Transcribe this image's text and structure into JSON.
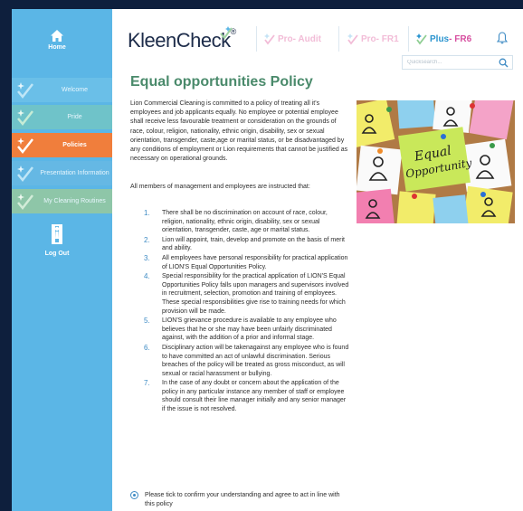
{
  "sidebar": {
    "home_label": "Home",
    "items": [
      {
        "label": "Welcome"
      },
      {
        "label": "Pride"
      },
      {
        "label": "Policies"
      },
      {
        "label": "Presentation Information"
      },
      {
        "label": "My Cleaning Routines"
      }
    ],
    "logout_label": "Log Out"
  },
  "header": {
    "logo_text": "KleenCheck",
    "logo_mark": "®",
    "tabs": [
      {
        "prefix": "Pro",
        "suffix": " - Audit"
      },
      {
        "prefix": "Pro",
        "suffix": " - FR1"
      },
      {
        "prefix": "Plus",
        "suffix": " - FR6"
      }
    ],
    "search_placeholder": "Quicksearch..."
  },
  "main": {
    "title": "Equal opportunities Policy",
    "intro": "Lion Commercial Cleaning is committed to a policy of treating all it's employees and job applicants equally. No employee or potential employee shall receive less favourable treatment or consideration on the grounds of race, colour, religion, nationality, ethnic origin, disability, sex or sexual orientation, transgender, caste,age or marital status, or be disadvantaged by any conditions of employment or Lion requirements that cannot be justified as necessary on operational grounds.",
    "members_intro": "All members of management and employees are instructed that:",
    "points": [
      {
        "num": "1.",
        "text": "There shall be no discrimination on account of race, colour, religion, nationality, ethnic origin, disability, sex or sexual orientation, transgender, caste, age or marital status."
      },
      {
        "num": "2.",
        "text": "Lion will appoint, train, develop and promote on the basis of merit and ability."
      },
      {
        "num": "3.",
        "text": "All employees have personal responsibility for practical application of LION'S Equal Opportunities Policy."
      },
      {
        "num": "4.",
        "text": "Special responsibility for the practical application of LION'S Equal Opportunities Policy falls upon managers and supervisors involved in recruitment, selection, promotion and training of employees. These special responsibilities give rise to training needs for which provision will be made."
      },
      {
        "num": "5.",
        "text": "LION'S grievance procedure is available to any employee who believes that he or she may have been unfairly discriminated against, with the addition of a prior and informal stage."
      },
      {
        "num": "6.",
        "text": "Disciplinary action will be takenagainst any employee who is found to have committed an act of unlawful discrimination. Serious breaches of the policy will be treated as gross misconduct, as will sexual or racial harassment or bullying."
      },
      {
        "num": "7.",
        "text": "In the case of any doubt or concern about the application of the policy in any particular instance any member of staff or employee should consult their line manager initially and any senior manager if the issue is not resolved."
      }
    ],
    "photo_note_text": [
      "Equal",
      "Opportunity"
    ],
    "confirm_text": "Please tick to confirm your understanding and agree to act in line with this policy",
    "confirm_checked": true
  },
  "colors": {
    "sidebar": "#5bb6e6",
    "active_item": "#f07e3c",
    "title_green": "#4a8a6b",
    "number_blue": "#3e8bc4",
    "tab_pink": "#d74fa0"
  }
}
